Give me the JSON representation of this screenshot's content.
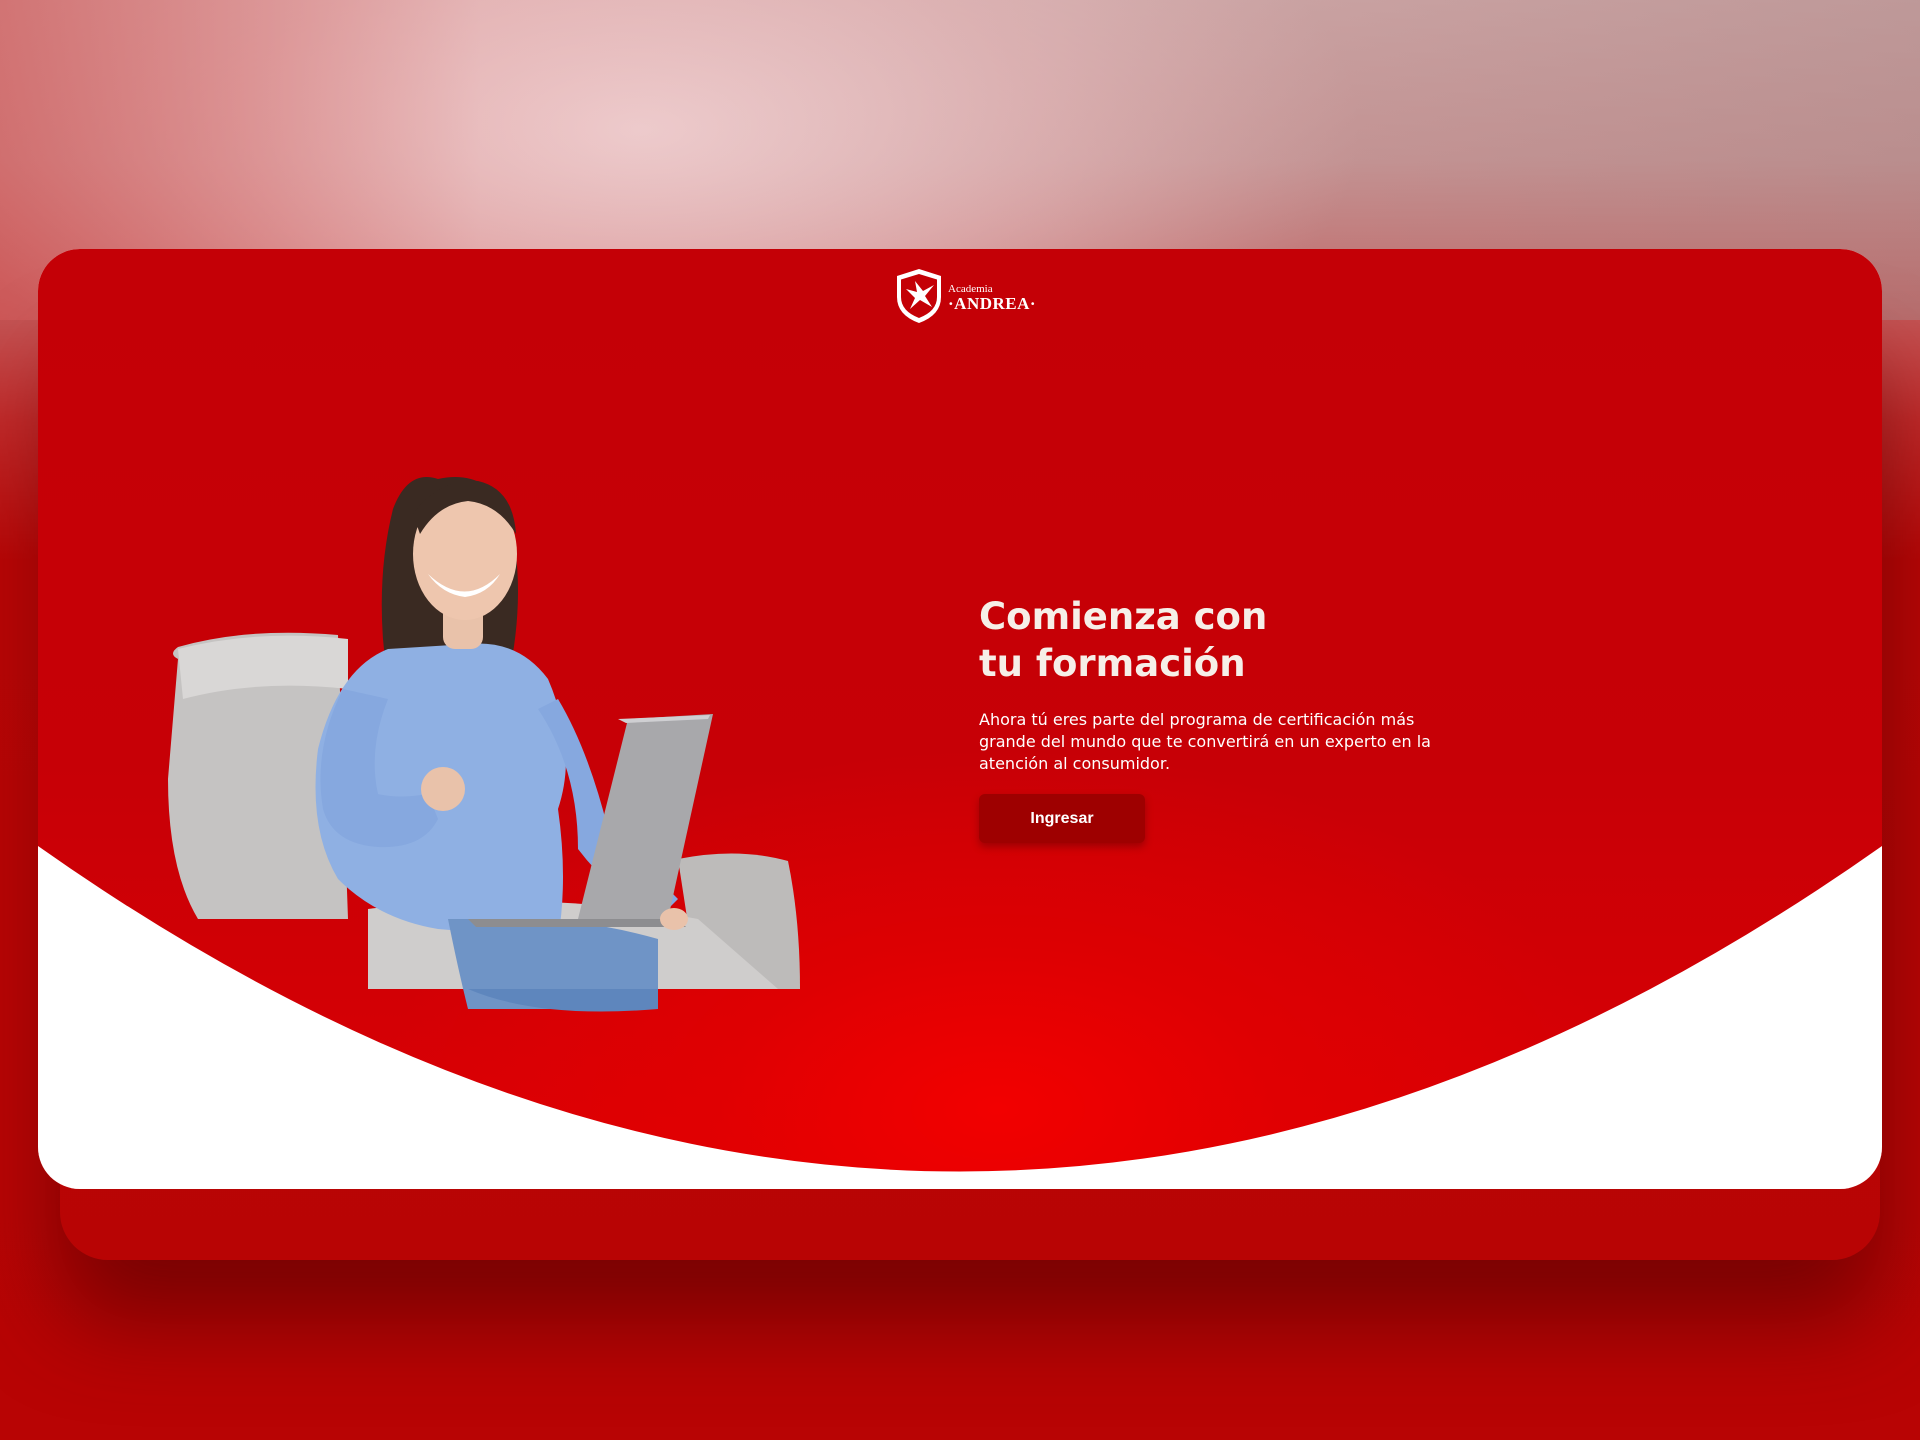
{
  "brand": {
    "logo_label_top": "Academia",
    "logo_label_bottom": "·ANDREA·",
    "logo_icon": "shield-star-icon"
  },
  "hero": {
    "headline": "Comienza con tu formación",
    "body": "Ahora tú eres parte del programa de certificación más grande del mundo que te convertirá en un experto en la atención al consumidor.",
    "cta_label": "Ingresar",
    "illustration": "woman-with-laptop-on-armchair"
  },
  "colors": {
    "brand_red": "#c40006",
    "button_red": "#9e0000",
    "text_light": "#f6efe8"
  }
}
